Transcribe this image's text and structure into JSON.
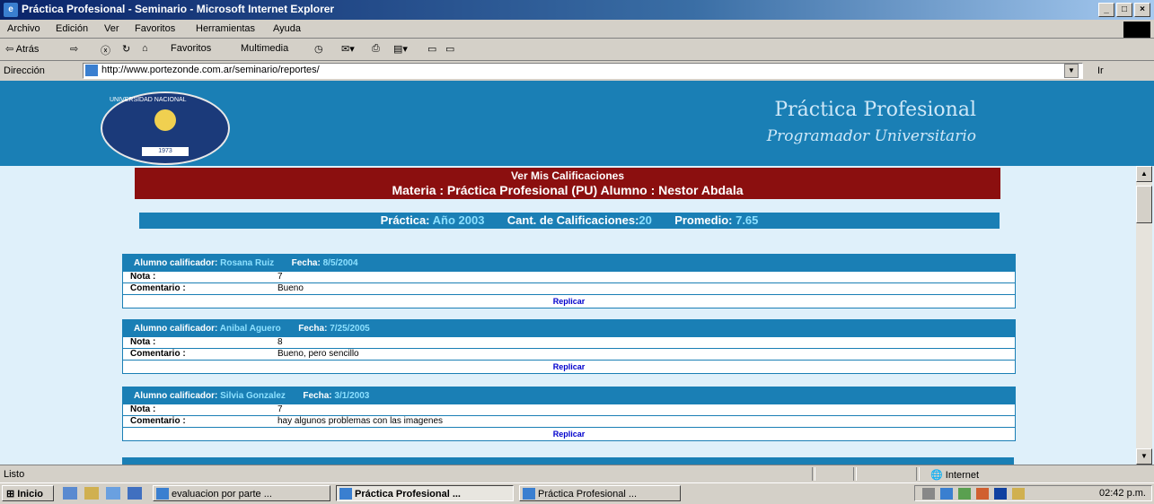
{
  "window": {
    "title": "Práctica Profesional - Seminario - Microsoft Internet Explorer",
    "buttons": [
      "_",
      "□",
      "×"
    ]
  },
  "menu": [
    "Archivo",
    "Edición",
    "Ver",
    "Favoritos",
    "Herramientas",
    "Ayuda"
  ],
  "toolbar": {
    "back": "⇦ Atrás",
    "forward": "⇨",
    "stop": "ⓧ",
    "refresh": "↻",
    "home": "⌂",
    "favorites": "Favoritos",
    "multimedia": "Multimedia"
  },
  "address": {
    "label": "Dirección",
    "url": "http://www.portezonde.com.ar/seminario/reportes/",
    "go": "Ir"
  },
  "banner": {
    "title": "Práctica Profesional",
    "subtitle": "Programador Universitario",
    "seal_ring": "UNIVERSIDAD NACIONAL",
    "seal_ribbon": "1973"
  },
  "header": {
    "line1": "Ver Mis Calificaciones",
    "line2": "Materia : Práctica Profesional (PU)     Alumno : Nestor Abdala"
  },
  "summary": {
    "practica_label": "Práctica: ",
    "practica_value": "Año 2003",
    "cant_label": "Cant. de Calificaciones:",
    "cant_value": "20",
    "prom_label": "Promedio: ",
    "prom_value": "7.65"
  },
  "cards": [
    {
      "alumno_label": "Alumno calificador: ",
      "alumno": "Rosana Ruiz",
      "fecha_label": "Fecha: ",
      "fecha": "8/5/2004",
      "nota_label": "Nota :",
      "nota": "7",
      "coment_label": "Comentario :",
      "coment": "Bueno",
      "replicar": "Replicar"
    },
    {
      "alumno_label": "Alumno calificador: ",
      "alumno": "Anibal Aguero",
      "fecha_label": "Fecha: ",
      "fecha": "7/25/2005",
      "nota_label": "Nota :",
      "nota": "8",
      "coment_label": "Comentario :",
      "coment": "Bueno, pero sencillo",
      "replicar": "Replicar"
    },
    {
      "alumno_label": "Alumno calificador: ",
      "alumno": "Silvia Gonzalez",
      "fecha_label": "Fecha: ",
      "fecha": "3/1/2003",
      "nota_label": "Nota :",
      "nota": "7",
      "coment_label": "Comentario :",
      "coment": "hay algunos problemas con las imagenes",
      "replicar": "Replicar"
    }
  ],
  "status": {
    "text": "Listo",
    "zone": "Internet"
  },
  "taskbar": {
    "start": "Inicio",
    "tasks": [
      "evaluacion por parte ...",
      "Práctica Profesional ...",
      "Práctica Profesional ..."
    ],
    "clock": "02:42 p.m."
  },
  "colors": {
    "banner": "#1a7fb5",
    "header": "#8b0f0f",
    "page_bg": "#dff0fa"
  }
}
